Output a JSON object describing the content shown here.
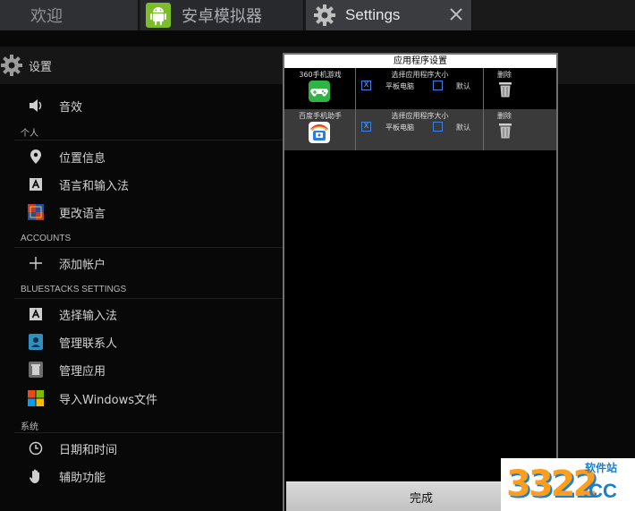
{
  "tabs": [
    {
      "label": "欢迎"
    },
    {
      "label": "安卓模拟器"
    },
    {
      "label": "Settings"
    }
  ],
  "settings": {
    "title": "设置",
    "items": [
      {
        "label": "音效",
        "icon": "speaker-icon"
      },
      {
        "section": "个人"
      },
      {
        "label": "位置信息",
        "icon": "location-pin-icon"
      },
      {
        "label": "语言和输入法",
        "icon": "keyboard-a-icon"
      },
      {
        "label": "更改语言",
        "icon": "language-flag-icon"
      },
      {
        "section": "ACCOUNTS"
      },
      {
        "label": "添加帐户",
        "icon": "plus-icon"
      },
      {
        "section": "BLUESTACKS SETTINGS"
      },
      {
        "label": "选择输入法",
        "icon": "keyboard-a-icon"
      },
      {
        "label": "管理联系人",
        "icon": "contacts-icon"
      },
      {
        "label": "管理应用",
        "icon": "apps-trash-icon"
      },
      {
        "label": "导入Windows文件",
        "icon": "windows-logo-icon"
      },
      {
        "section": "系统"
      },
      {
        "label": "日期和时间",
        "icon": "clock-icon"
      },
      {
        "label": "辅助功能",
        "icon": "hand-icon"
      }
    ]
  },
  "dialog": {
    "title": "应用程序设置",
    "apps": [
      {
        "name": "360手机游戏",
        "icon": "gamepad-icon",
        "size_label": "选择应用程序大小",
        "tablet_label": "平板电脑",
        "tablet_checked": "X",
        "default_label": "默认",
        "delete_label": "删除"
      },
      {
        "name": "百度手机助手",
        "icon": "baidu-assistant-icon",
        "size_label": "选择应用程序大小",
        "tablet_label": "平板电脑",
        "tablet_checked": "X",
        "default_label": "默认",
        "delete_label": "删除"
      }
    ],
    "done_label": "完成"
  },
  "watermark": {
    "number": "3322",
    "text": "软件站",
    "domain": ".CC"
  },
  "colors": {
    "accent": "#3f7fe0",
    "android_green": "#7cbd2a",
    "watermark_orange": "#ff9d1c",
    "watermark_blue": "#1a7fd1"
  }
}
